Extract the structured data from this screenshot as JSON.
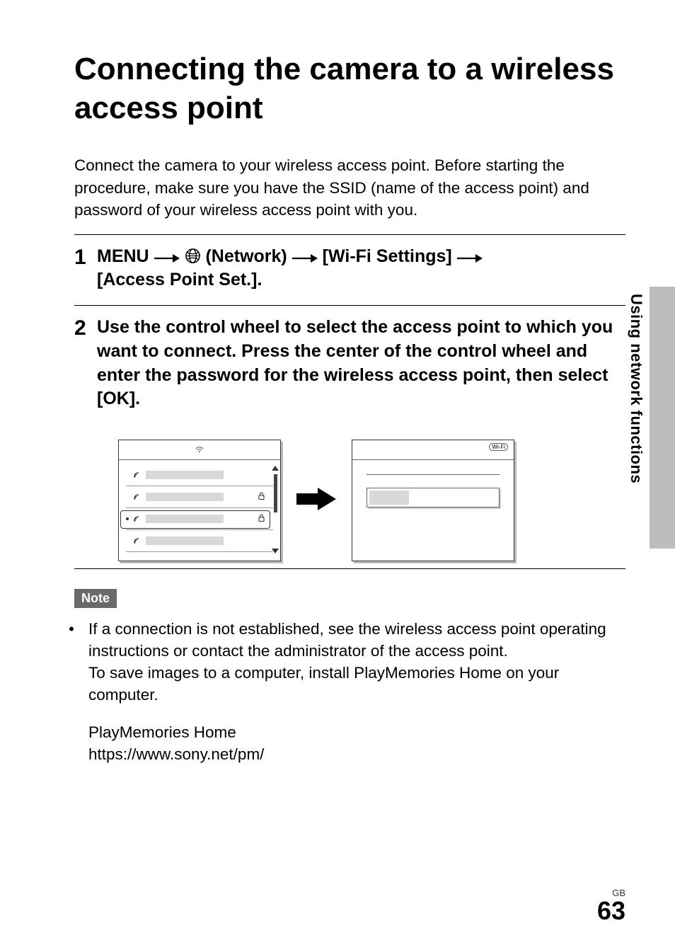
{
  "title": "Connecting the camera to a wireless access point",
  "intro": "Connect the camera to your wireless access point. Before starting the procedure, make sure you have the SSID (name of the access point) and password of your wireless access point with you.",
  "step1": {
    "num": "1",
    "menu": "MENU",
    "network": "(Network)",
    "wifi": "[Wi-Fi Settings]",
    "ap": "[Access Point Set.]."
  },
  "step2": {
    "num": "2",
    "text": "Use the control wheel to select the access point to which you want to connect. Press the center of the control wheel and enter the password for the wireless access point, then select [OK]."
  },
  "screen2_badge": "Wi-Fi",
  "note": {
    "label": "Note",
    "bullet_text": "If a connection is not established, see the wireless access point operating instructions or contact the administrator of the access point.",
    "extra_line": "To save images to a computer, install PlayMemories Home on your computer.",
    "product": "PlayMemories Home",
    "url": "https://www.sony.net/pm/"
  },
  "side_label": "Using network functions",
  "footer": {
    "region": "GB",
    "page": "63"
  }
}
